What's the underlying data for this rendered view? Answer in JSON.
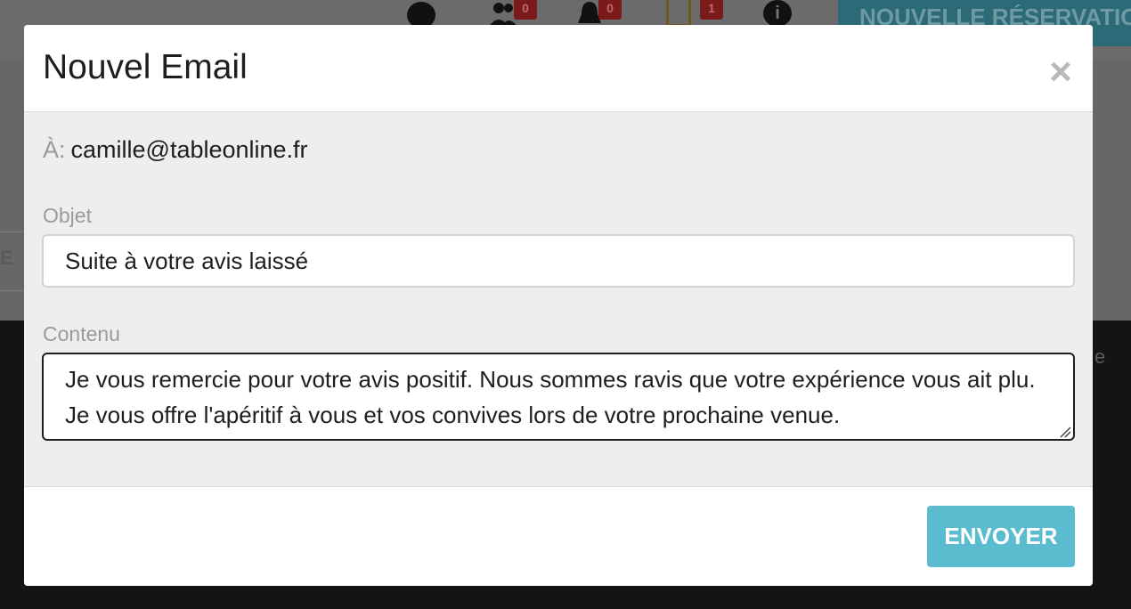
{
  "background": {
    "badges": {
      "users": "0",
      "alerts": "0",
      "docs": "1"
    },
    "info_glyph": "i",
    "new_reservation_label": "NOUVELLE RÉSERVATIO",
    "edge_text": "E",
    "side_text": "e"
  },
  "modal": {
    "title": "Nouvel Email",
    "close_glyph": "×",
    "to_label": "À:",
    "to_value": "camille@tableonline.fr",
    "subject_label": "Objet",
    "subject_value": "Suite à votre avis laissé",
    "content_label": "Contenu",
    "content_value": "Je vous remercie pour votre avis positif. Nous sommes ravis que votre expérience vous ait plu. Je vous offre l'apéritif à vous et vos convives lors de votre prochaine venue.",
    "send_label": "ENVOYER"
  },
  "colors": {
    "accent": "#5bbcd0",
    "badge": "#7a1a1a"
  }
}
